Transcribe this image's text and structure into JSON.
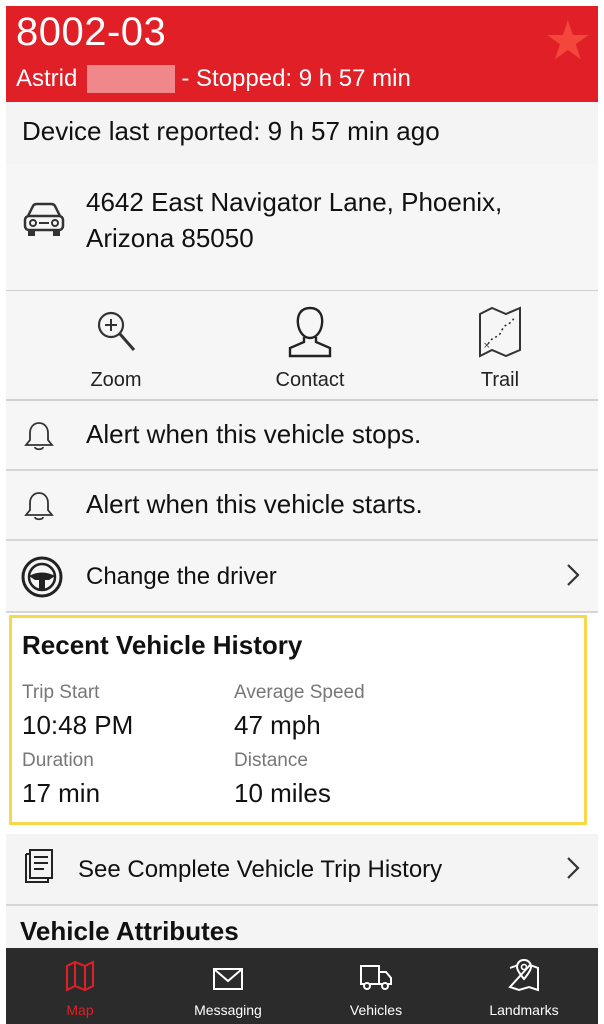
{
  "header": {
    "title": "8002-03",
    "driver_name": "Astrid",
    "status": "- Stopped: 9 h  57 min",
    "favorite_icon": "star-icon",
    "bg_color": "#e01f26"
  },
  "device_reported": "Device last reported: 9 h  57 min  ago",
  "address": {
    "icon": "car-icon",
    "line1": "4642 East Navigator Lane, Phoenix,",
    "line2": "Arizona 85050"
  },
  "actions": [
    {
      "label": "Zoom",
      "icon": "zoom-in-icon"
    },
    {
      "label": "Contact",
      "icon": "contact-icon"
    },
    {
      "label": "Trail",
      "icon": "trail-map-icon"
    }
  ],
  "alerts": {
    "stops": "Alert when this vehicle stops.",
    "starts": "Alert when this vehicle starts."
  },
  "driver_change": {
    "label": "Change the driver",
    "icon": "steering-wheel-icon"
  },
  "history": {
    "title": "Recent Vehicle History",
    "trip_start_label": "Trip Start",
    "trip_start_value": "10:48 PM",
    "avg_speed_label": "Average Speed",
    "avg_speed_value": "47 mph",
    "duration_label": "Duration",
    "duration_value": "17 min",
    "distance_label": "Distance",
    "distance_value": "10 miles",
    "highlight_color": "#f5d94a"
  },
  "trip_history": {
    "label": "See Complete Vehicle Trip History",
    "icon": "document-icon"
  },
  "attributes_heading": "Vehicle Attributes",
  "tabs": [
    {
      "label": "Map",
      "icon": "map-icon",
      "active": true
    },
    {
      "label": "Messaging",
      "icon": "envelope-icon",
      "active": false
    },
    {
      "label": "Vehicles",
      "icon": "truck-icon",
      "active": false
    },
    {
      "label": "Landmarks",
      "icon": "landmark-pin-icon",
      "active": false
    }
  ]
}
